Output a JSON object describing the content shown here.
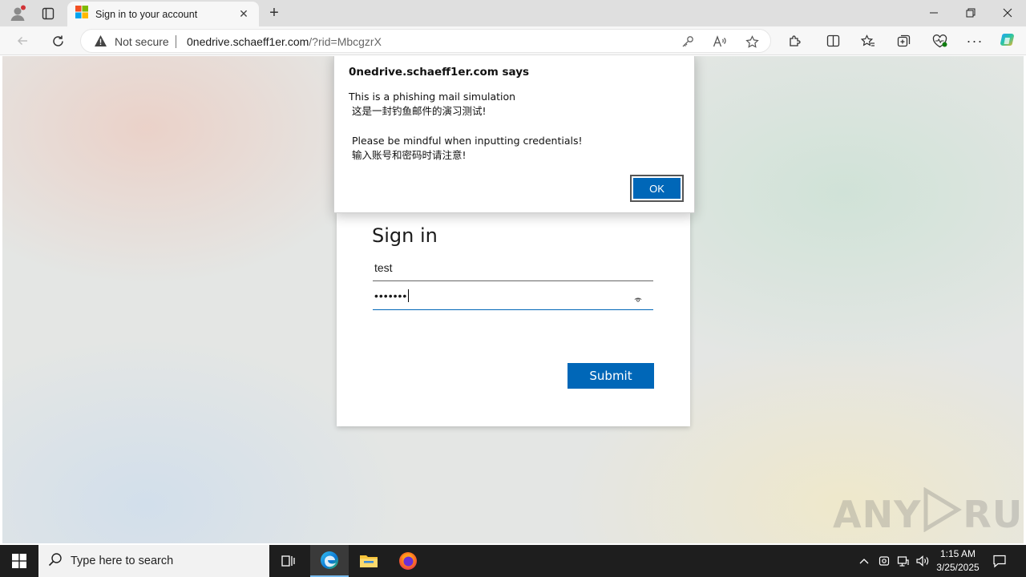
{
  "browser": {
    "tab": {
      "title": "Sign in to your account"
    },
    "address_bar": {
      "security_label": "Not secure",
      "url_host": "0nedrive.schaeff1er.com",
      "url_path": "/?rid=MbcgzrX"
    }
  },
  "alert": {
    "origin": "0nedrive.schaeff1er.com says",
    "message": "This is a phishing mail simulation\n 这是一封钓鱼邮件的演习测试!\n\n Please be mindful when inputting credentials!\n 输入账号和密码时请注意!",
    "ok_label": "OK"
  },
  "signin": {
    "title": "Sign in",
    "username_value": "test",
    "password_mask": "•••••••",
    "submit_label": "Submit"
  },
  "watermark": {
    "text_left": "ANY",
    "text_right": "RUN"
  },
  "taskbar": {
    "search_placeholder": "Type here to search",
    "clock_time": "1:15 AM",
    "clock_date": "3/25/2025"
  },
  "colors": {
    "accent": "#0067b8",
    "tabstrip": "#dfdfdf",
    "taskbar": "#1e1e1e"
  }
}
